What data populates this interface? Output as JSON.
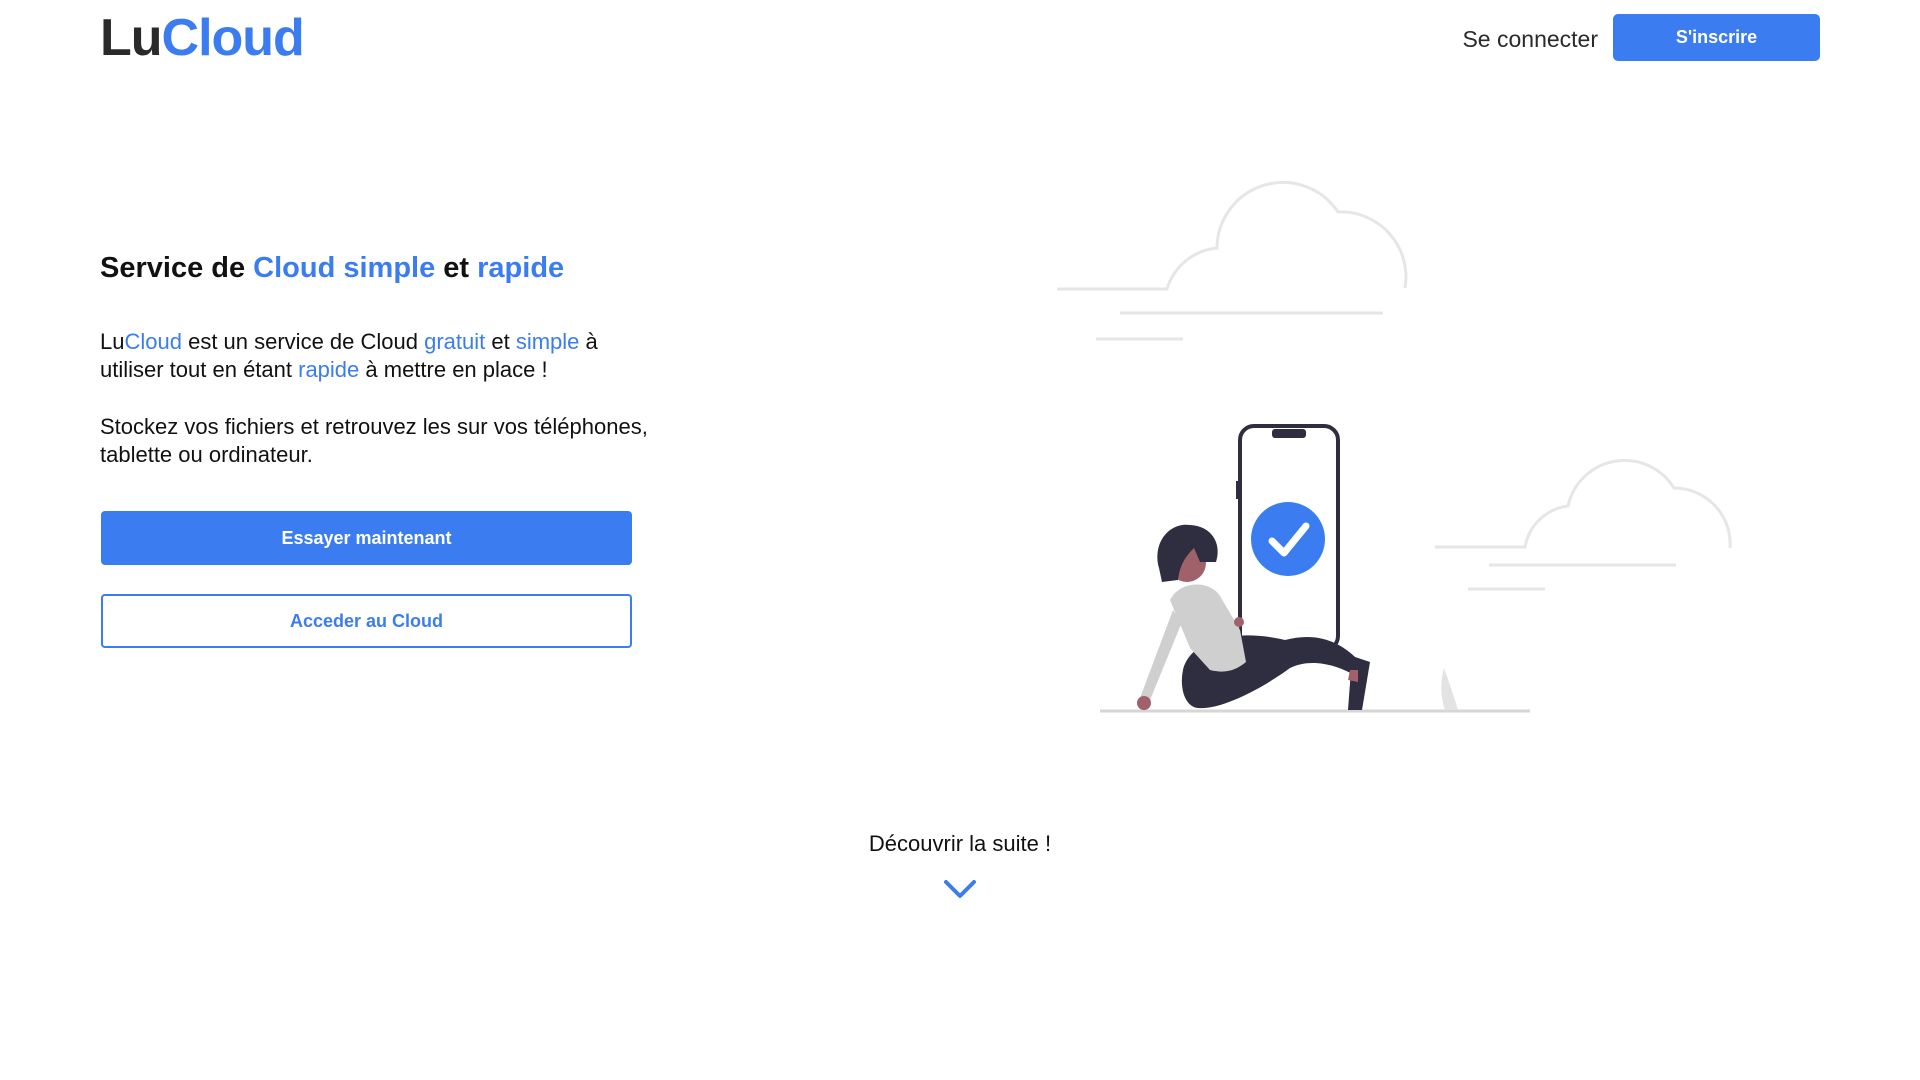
{
  "header": {
    "logo_part1": "Lu",
    "logo_part2": "Cloud",
    "login_label": "Se connecter",
    "signup_label": "S'inscrire"
  },
  "hero": {
    "title_parts": [
      "Service de ",
      "Cloud simple",
      " et ",
      "rapide"
    ],
    "para1_parts": [
      "Lu",
      "Cloud",
      " est un service de Cloud ",
      "gratuit",
      " et ",
      "simple",
      " à utiliser tout en étant ",
      "rapide",
      " à mettre en place !"
    ],
    "para2": "Stockez vos fichiers et retrouvez les sur vos téléphones, tablette ou ordinateur.",
    "primary_button": "Essayer maintenant",
    "secondary_button": "Acceder au Cloud"
  },
  "illustration": {
    "icon": "person-with-phone-checkmark-illustration"
  },
  "discover": {
    "label": "Découvrir la suite !",
    "icon": "chevron-down-icon"
  },
  "colors": {
    "accent": "#3b7df0",
    "text": "#111111",
    "cloud_stroke": "#e6e6e6",
    "figure_dark": "#2f2e41"
  }
}
